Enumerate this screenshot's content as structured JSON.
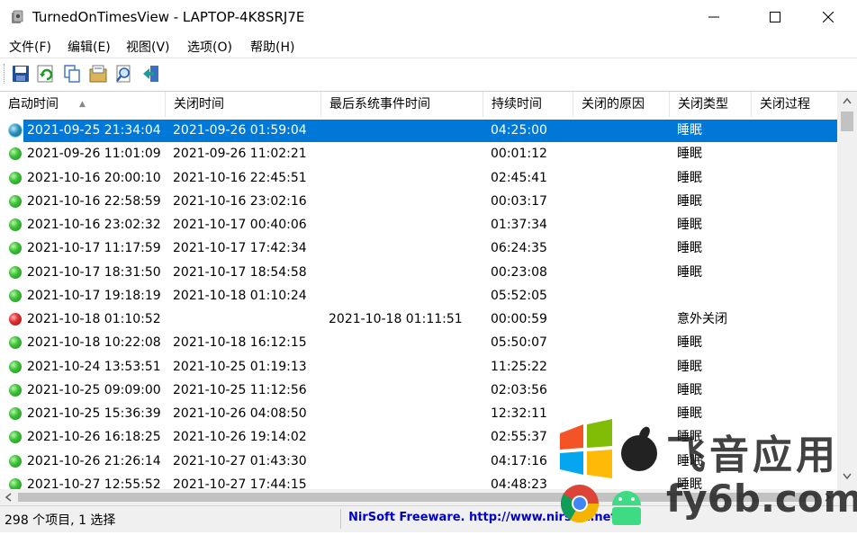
{
  "window": {
    "title": "TurnedOnTimesView  -  LAPTOP-4K8SRJ7E"
  },
  "menu": [
    "文件(F)",
    "编辑(E)",
    "视图(V)",
    "选项(O)",
    "帮助(H)"
  ],
  "toolbar": {
    "buttons": [
      "save-icon",
      "refresh-icon",
      "copy-icon",
      "properties-icon",
      "find-icon",
      "exit-icon"
    ]
  },
  "columns": [
    "启动时间",
    "关闭时间",
    "最后系统事件时间",
    "持续时间",
    "关闭的原因",
    "关闭类型",
    "关闭过程"
  ],
  "rows": [
    {
      "status": "selected",
      "start": "2021-09-25 21:34:04",
      "end": "2021-09-26 01:59:04",
      "last": "",
      "duration": "04:25:00",
      "reason": "",
      "type": "睡眠"
    },
    {
      "status": "green",
      "start": "2021-09-26 11:01:09",
      "end": "2021-09-26 11:02:21",
      "last": "",
      "duration": "00:01:12",
      "reason": "",
      "type": "睡眠"
    },
    {
      "status": "green",
      "start": "2021-10-16 20:00:10",
      "end": "2021-10-16 22:45:51",
      "last": "",
      "duration": "02:45:41",
      "reason": "",
      "type": "睡眠"
    },
    {
      "status": "green",
      "start": "2021-10-16 22:58:59",
      "end": "2021-10-16 23:02:16",
      "last": "",
      "duration": "00:03:17",
      "reason": "",
      "type": "睡眠"
    },
    {
      "status": "green",
      "start": "2021-10-16 23:02:32",
      "end": "2021-10-17 00:40:06",
      "last": "",
      "duration": "01:37:34",
      "reason": "",
      "type": "睡眠"
    },
    {
      "status": "green",
      "start": "2021-10-17 11:17:59",
      "end": "2021-10-17 17:42:34",
      "last": "",
      "duration": "06:24:35",
      "reason": "",
      "type": "睡眠"
    },
    {
      "status": "green",
      "start": "2021-10-17 18:31:50",
      "end": "2021-10-17 18:54:58",
      "last": "",
      "duration": "00:23:08",
      "reason": "",
      "type": "睡眠"
    },
    {
      "status": "green",
      "start": "2021-10-17 19:18:19",
      "end": "2021-10-18 01:10:24",
      "last": "",
      "duration": "05:52:05",
      "reason": "",
      "type": ""
    },
    {
      "status": "red",
      "start": "2021-10-18 01:10:52",
      "end": "",
      "last": "2021-10-18 01:11:51",
      "duration": "00:00:59",
      "reason": "",
      "type": "意外关闭"
    },
    {
      "status": "green",
      "start": "2021-10-18 10:22:08",
      "end": "2021-10-18 16:12:15",
      "last": "",
      "duration": "05:50:07",
      "reason": "",
      "type": "睡眠"
    },
    {
      "status": "green",
      "start": "2021-10-24 13:53:51",
      "end": "2021-10-25 01:19:13",
      "last": "",
      "duration": "11:25:22",
      "reason": "",
      "type": "睡眠"
    },
    {
      "status": "green",
      "start": "2021-10-25 09:09:00",
      "end": "2021-10-25 11:12:56",
      "last": "",
      "duration": "02:03:56",
      "reason": "",
      "type": "睡眠"
    },
    {
      "status": "green",
      "start": "2021-10-25 15:36:39",
      "end": "2021-10-26 04:08:50",
      "last": "",
      "duration": "12:32:11",
      "reason": "",
      "type": "睡眠"
    },
    {
      "status": "green",
      "start": "2021-10-26 16:18:25",
      "end": "2021-10-26 19:14:02",
      "last": "",
      "duration": "02:55:37",
      "reason": "",
      "type": "睡眠"
    },
    {
      "status": "green",
      "start": "2021-10-26 21:26:14",
      "end": "2021-10-27 01:43:30",
      "last": "",
      "duration": "04:17:16",
      "reason": "",
      "type": "睡眠"
    },
    {
      "status": "green",
      "start": "2021-10-27 12:55:52",
      "end": "2021-10-27 17:44:15",
      "last": "",
      "duration": "04:48:23",
      "reason": "",
      "type": "睡眠"
    }
  ],
  "status": {
    "items": "298 个项目, 1 选择",
    "link": "NirSoft Freeware.  http://www.nirsoft.net"
  },
  "watermark": {
    "line1": "飞音应用",
    "line2": "fy6b.com"
  },
  "colors": {
    "selection": "#0078d7",
    "link": "#0000cc"
  }
}
